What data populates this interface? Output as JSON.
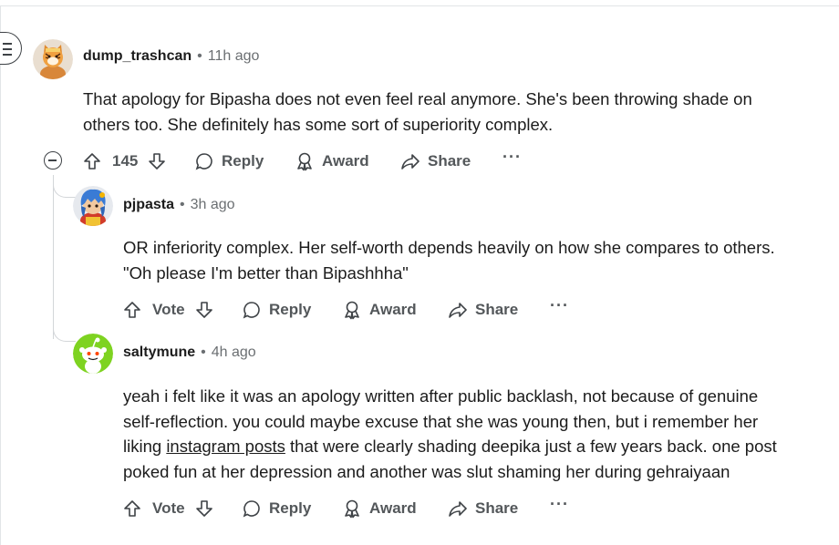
{
  "comments": [
    {
      "username": "dump_trashcan",
      "time": "11h ago",
      "body": [
        "That apology for Bipasha does not even feel real anymore. She's been throwing shade on",
        "others too. She definitely has some sort of superiority complex."
      ],
      "vote_count": "145",
      "reply_label": "Reply",
      "award_label": "Award",
      "share_label": "Share",
      "more_label": "···",
      "avatar_icon": "tiger-avatar-icon"
    },
    {
      "username": "pjpasta",
      "time": "3h ago",
      "body": [
        "OR inferiority complex. Her self-worth depends heavily on how she compares to others.",
        "\"Oh please I'm better than Bipashhha\""
      ],
      "vote_label": "Vote",
      "reply_label": "Reply",
      "award_label": "Award",
      "share_label": "Share",
      "more_label": "···",
      "avatar_icon": "blue-haired-avatar-icon"
    },
    {
      "username": "saltymune",
      "time": "4h ago",
      "body_line1": "yeah i felt like it was an apology written after public backlash, not because of genuine",
      "body_line2": "self-reflection. you could maybe excuse that she was young then, but i remember her",
      "body_line3_pre": "liking ",
      "body_line3_link": "instagram posts",
      "body_line3_post": " that were clearly shading deepika just a few years back. one post",
      "body_line4": "poked fun at her depression and another was slut shaming her during gehraiyaan",
      "vote_label": "Vote",
      "reply_label": "Reply",
      "award_label": "Award",
      "share_label": "Share",
      "more_label": "···",
      "avatar_icon": "snoo-avatar-icon"
    }
  ],
  "separator": "•",
  "colors": {
    "text": "#1c1c1c",
    "meta": "#6b6f72",
    "action": "#53575a",
    "thread_line": "#d3d6d9",
    "snoo_green": "#7ed321"
  }
}
